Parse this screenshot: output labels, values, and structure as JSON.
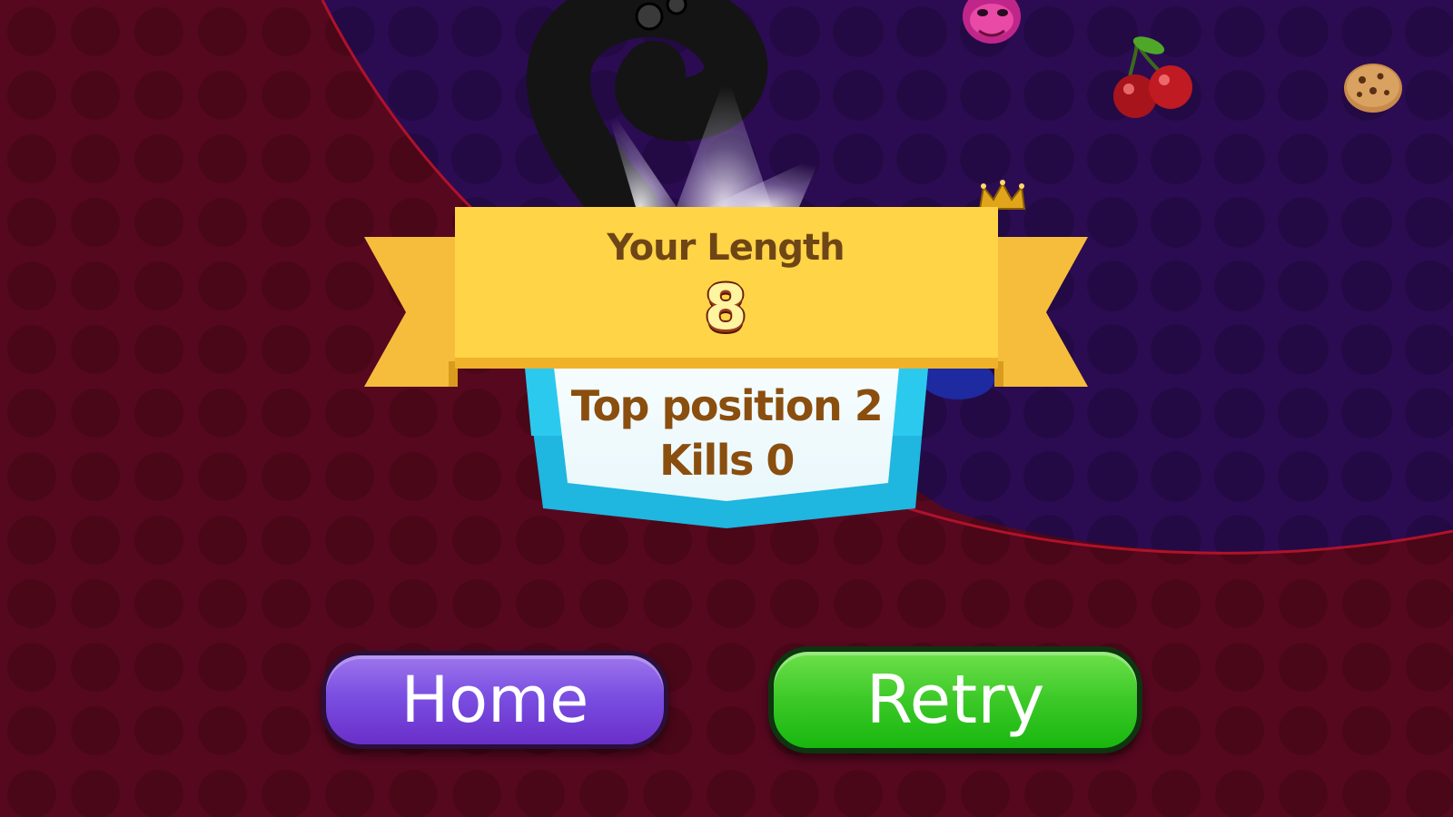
{
  "result": {
    "title": "Your Length",
    "length_value": "8",
    "top_position_line": "Top position 2",
    "kills_line": "Kills 0"
  },
  "buttons": {
    "home_label": "Home",
    "retry_label": "Retry"
  },
  "colors": {
    "background_red": "#55081f",
    "arena_purple": "#2a0c4e",
    "banner_yellow": "#ffd447",
    "shield_cyan": "#22c6e8",
    "home_purple": "#7a4fe2",
    "retry_green": "#3cc928",
    "label_brown": "#8a4e0f"
  },
  "icons": [
    "worm-icon",
    "worm-head-icon",
    "cherry-icon",
    "cookie-icon",
    "crown-icon",
    "spotlight-icon"
  ]
}
